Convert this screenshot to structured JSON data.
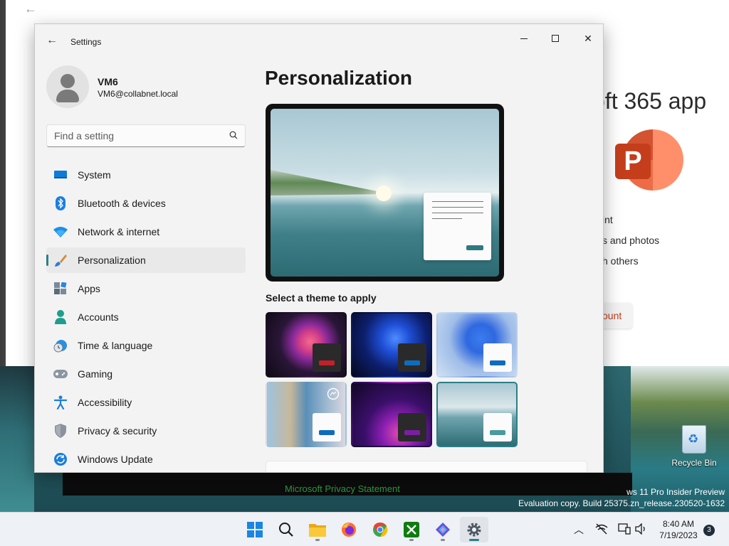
{
  "background_app": {
    "title": "oft 365 app",
    "lines": [
      "int",
      "s and photos",
      "h others"
    ],
    "button_label": "ount",
    "logo_letter": "P"
  },
  "desktop": {
    "privacy_link": "Microsoft Privacy Statement",
    "watermark": [
      "ws 11 Pro Insider Preview",
      "Evaluation copy. Build 25375.zn_release.230520-1632"
    ],
    "recycle_bin_label": "Recycle Bin"
  },
  "settings": {
    "title": "Settings",
    "user": {
      "name": "VM6",
      "email": "VM6@collabnet.local"
    },
    "search_placeholder": "Find a setting",
    "nav": [
      {
        "label": "System",
        "icon": "system-icon",
        "active": false
      },
      {
        "label": "Bluetooth & devices",
        "icon": "bluetooth-icon",
        "active": false
      },
      {
        "label": "Network & internet",
        "icon": "network-icon",
        "active": false
      },
      {
        "label": "Personalization",
        "icon": "paintbrush-icon",
        "active": true
      },
      {
        "label": "Apps",
        "icon": "apps-icon",
        "active": false
      },
      {
        "label": "Accounts",
        "icon": "accounts-icon",
        "active": false
      },
      {
        "label": "Time & language",
        "icon": "clock-globe-icon",
        "active": false
      },
      {
        "label": "Gaming",
        "icon": "gamepad-icon",
        "active": false
      },
      {
        "label": "Accessibility",
        "icon": "accessibility-icon",
        "active": false
      },
      {
        "label": "Privacy & security",
        "icon": "shield-icon",
        "active": false
      },
      {
        "label": "Windows Update",
        "icon": "update-icon",
        "active": false
      }
    ],
    "page_title": "Personalization",
    "theme_heading": "Select a theme to apply",
    "themes": [
      {
        "name": "flower-dark",
        "accent": "#c4202a",
        "selected": false
      },
      {
        "name": "bloom-dark",
        "accent": "#0f6cbd",
        "selected": false
      },
      {
        "name": "bloom-light",
        "accent": "#0f6cbd",
        "selected": false
      },
      {
        "name": "spotlight",
        "accent": "#0f6cbd",
        "selected": false
      },
      {
        "name": "glow",
        "accent": "#7a1fa2",
        "selected": false
      },
      {
        "name": "lake",
        "accent": "#4a9aa0",
        "selected": true
      }
    ]
  },
  "taskbar": {
    "apps": [
      "start-icon",
      "search-icon",
      "file-explorer-icon",
      "firefox-icon",
      "chrome-icon",
      "xbox-icon",
      "copilot-icon",
      "settings-icon"
    ],
    "active_app": "settings-icon",
    "clock_time": "8:40 AM",
    "clock_date": "7/19/2023",
    "notification_count": "3"
  },
  "colors": {
    "accent": "#2a7f88",
    "window_bg": "#f3f3f3",
    "taskbar_bg": "#eef1f5"
  }
}
